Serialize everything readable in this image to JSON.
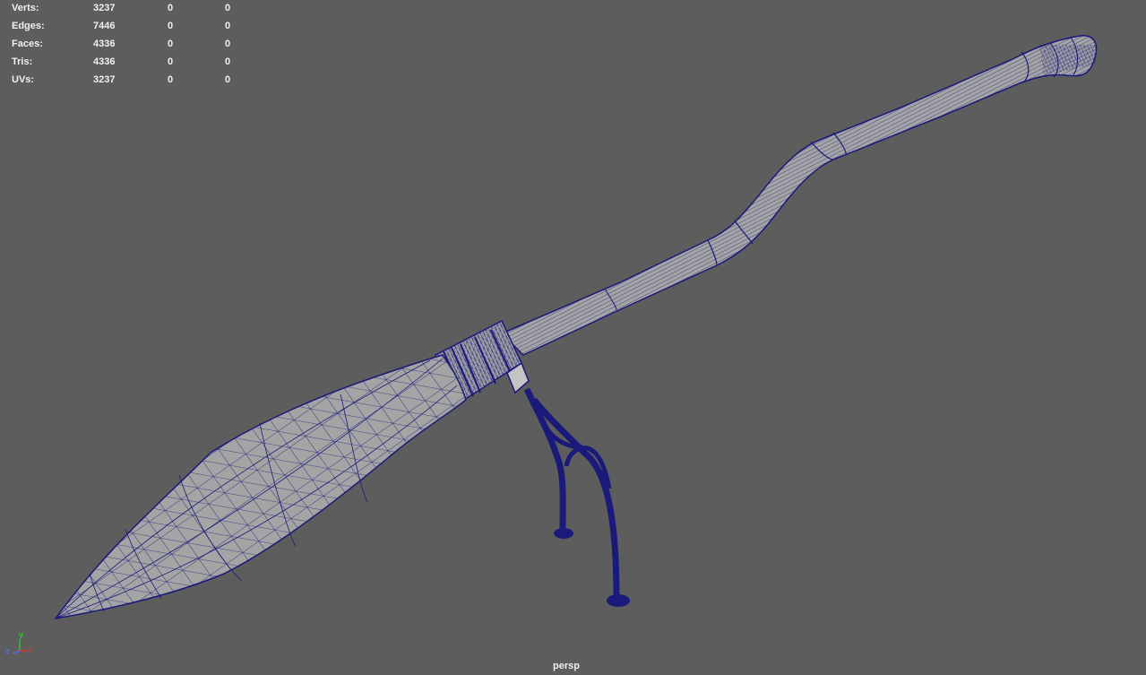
{
  "stats": {
    "rows": [
      {
        "label": "Verts:",
        "values": [
          "3237",
          "0",
          "0"
        ]
      },
      {
        "label": "Edges:",
        "values": [
          "7446",
          "0",
          "0"
        ]
      },
      {
        "label": "Faces:",
        "values": [
          "4336",
          "0",
          "0"
        ]
      },
      {
        "label": "Tris:",
        "values": [
          "4336",
          "0",
          "0"
        ]
      },
      {
        "label": "UVs:",
        "values": [
          "3237",
          "0",
          "0"
        ]
      }
    ]
  },
  "viewport": {
    "camera": "persp",
    "background_color": "#5d5d5d",
    "wireframe_color": "#1a1a7a",
    "mesh_color": "#a4a4a4"
  },
  "axis": {
    "y": "y",
    "z": "z",
    "x": "x",
    "y_color": "#34c234",
    "z_color": "#4a6ef0",
    "x_color": "#e03030"
  }
}
